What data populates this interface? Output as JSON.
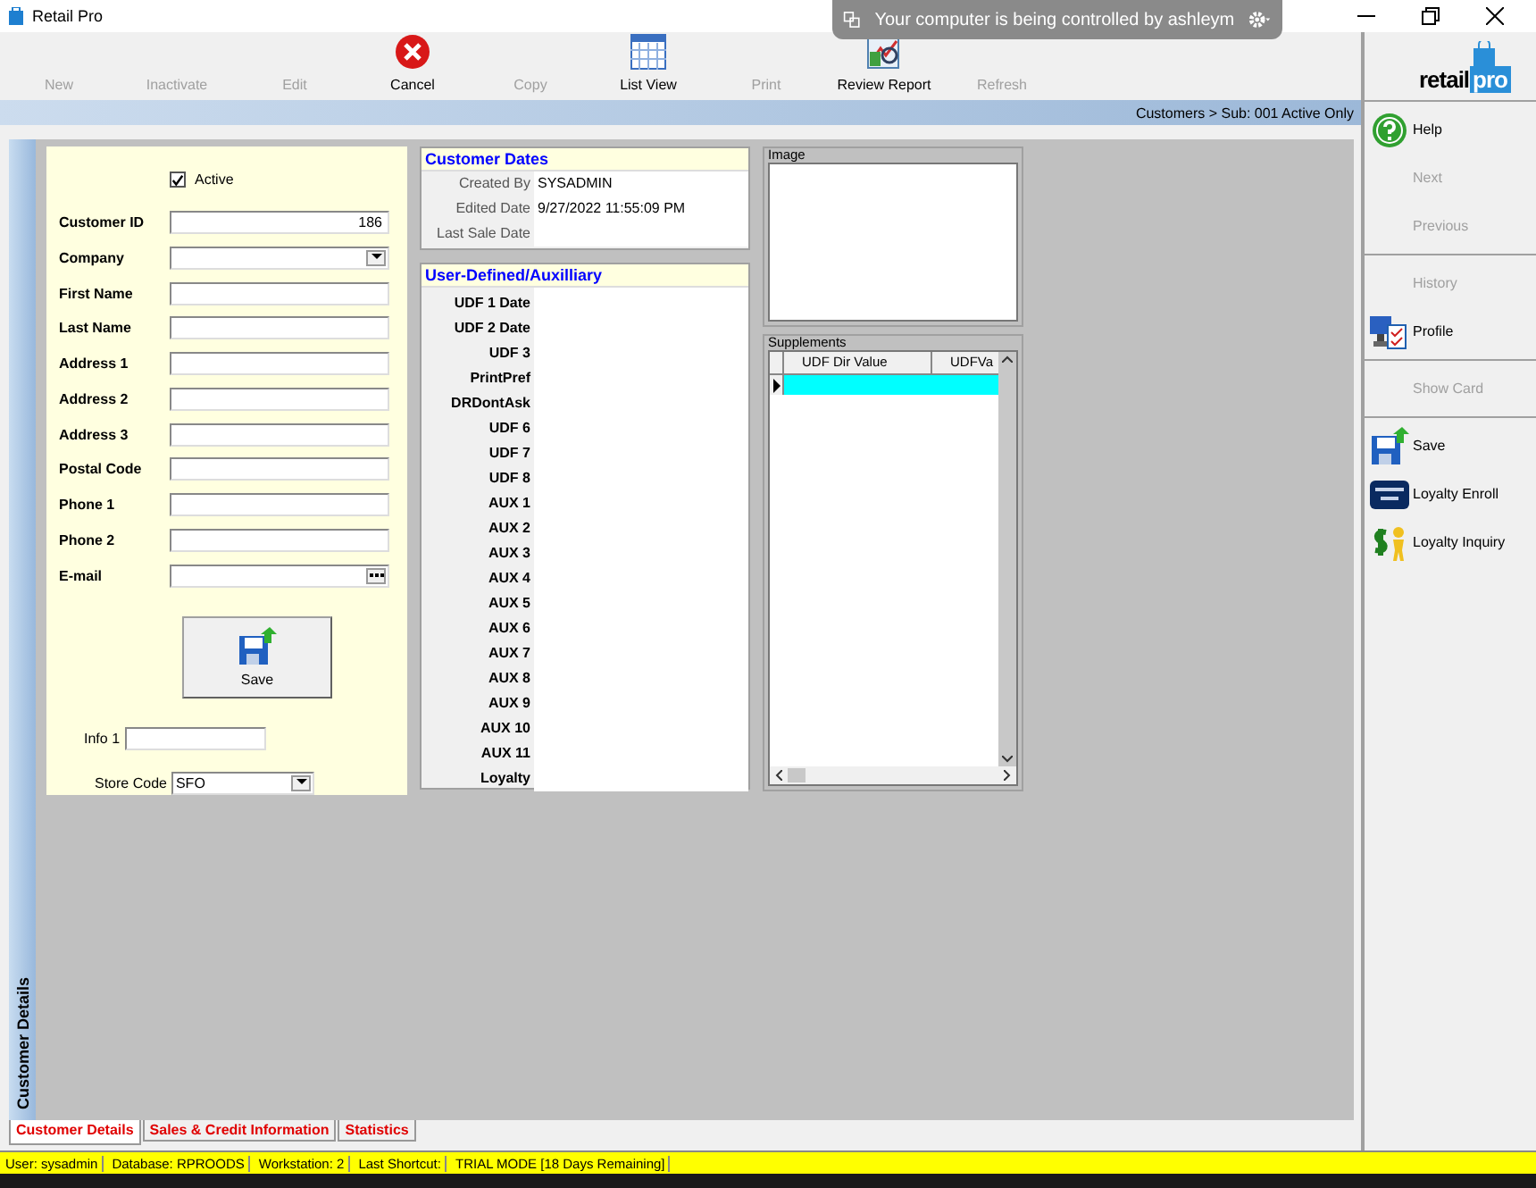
{
  "window": {
    "title": "Retail Pro"
  },
  "remote_banner": {
    "text": "Your computer is being controlled by ashleym"
  },
  "toolbar": [
    {
      "label": "New",
      "disabled": true,
      "kind": "none"
    },
    {
      "label": "Inactivate",
      "disabled": true,
      "kind": "none"
    },
    {
      "label": "Edit",
      "disabled": true,
      "kind": "none"
    },
    {
      "label": "Cancel",
      "disabled": false,
      "kind": "cancel"
    },
    {
      "label": "Copy",
      "disabled": true,
      "kind": "none"
    },
    {
      "label": "List View",
      "disabled": false,
      "kind": "grid"
    },
    {
      "label": "Print",
      "disabled": true,
      "kind": "none"
    },
    {
      "label": "Review Report",
      "disabled": false,
      "kind": "report"
    },
    {
      "label": "Refresh",
      "disabled": true,
      "kind": "none"
    }
  ],
  "logo": {
    "part_1": "retail",
    "part_2": "pro"
  },
  "breadcrumb": "Customers > Sub: 001 Active Only",
  "side_tab": "Customer Details",
  "form": {
    "active": {
      "label": "Active",
      "checked": true
    },
    "fields": [
      {
        "label": "Customer ID",
        "value": "186",
        "kind": "text"
      },
      {
        "label": "Company",
        "kind": "combo"
      },
      {
        "label": "First Name",
        "kind": "text"
      },
      {
        "label": "Last Name",
        "kind": "text"
      },
      {
        "label": "Address 1",
        "kind": "text"
      },
      {
        "label": "Address 2",
        "kind": "text"
      },
      {
        "label": "Address 3",
        "kind": "text"
      },
      {
        "label": "Postal Code",
        "kind": "text"
      },
      {
        "label": "Phone 1",
        "kind": "text"
      },
      {
        "label": "Phone 2",
        "kind": "text"
      },
      {
        "label": "E-mail",
        "kind": "ellipsis"
      }
    ],
    "save_button": "Save",
    "info_1": {
      "label": "Info 1"
    },
    "store_code": {
      "label": "Store Code",
      "value": "SFO"
    }
  },
  "customer_dates": {
    "title": "Customer Dates",
    "rows": [
      {
        "label": "Created By",
        "value": "SYSADMIN"
      },
      {
        "label": "Edited Date",
        "value": "9/27/2022 11:55:09 PM"
      },
      {
        "label": "Last Sale Date"
      }
    ]
  },
  "user_defined": {
    "title": "User-Defined/Auxilliary",
    "labels": [
      "UDF 1 Date",
      "UDF 2 Date",
      "UDF 3",
      "PrintPref",
      "DRDontAsk",
      "UDF 6",
      "UDF 7",
      "UDF 8",
      "AUX 1",
      "AUX 2",
      "AUX 3",
      "AUX 4",
      "AUX 5",
      "AUX 6",
      "AUX 7",
      "AUX 8",
      "AUX 9",
      "AUX 10",
      "AUX 11",
      "Loyalty"
    ]
  },
  "image": {
    "title": "Image"
  },
  "supplements": {
    "title": "Supplements",
    "columns": [
      "UDF Dir Value",
      "UDFVa"
    ],
    "rows": [
      {
        "selected": true
      }
    ]
  },
  "sidebar": {
    "groups": [
      [
        {
          "label": "Help",
          "disabled": false,
          "kind": "help"
        },
        {
          "label": "Next",
          "disabled": true,
          "kind": "none"
        },
        {
          "label": "Previous",
          "disabled": true,
          "kind": "none"
        }
      ],
      [
        {
          "label": "History",
          "disabled": true,
          "kind": "none"
        },
        {
          "label": "Profile",
          "disabled": false,
          "kind": "profile"
        }
      ],
      [
        {
          "label": "Show Card",
          "disabled": true,
          "kind": "none"
        }
      ],
      [
        {
          "label": "Save",
          "disabled": false,
          "kind": "save"
        },
        {
          "label": "Loyalty Enroll",
          "disabled": false,
          "kind": "loyalty"
        },
        {
          "label": "Loyalty Inquiry",
          "disabled": false,
          "kind": "money"
        }
      ]
    ]
  },
  "tabs": [
    {
      "label": "Customer Details",
      "selected": true
    },
    {
      "label": "Sales & Credit Information",
      "selected": false
    },
    {
      "label": "Statistics",
      "selected": false
    }
  ],
  "status_bar": [
    "User: sysadmin",
    "Database: RPROODS",
    "Workstation: 2",
    "Last Shortcut:",
    "TRIAL MODE [18 Days Remaining]"
  ]
}
